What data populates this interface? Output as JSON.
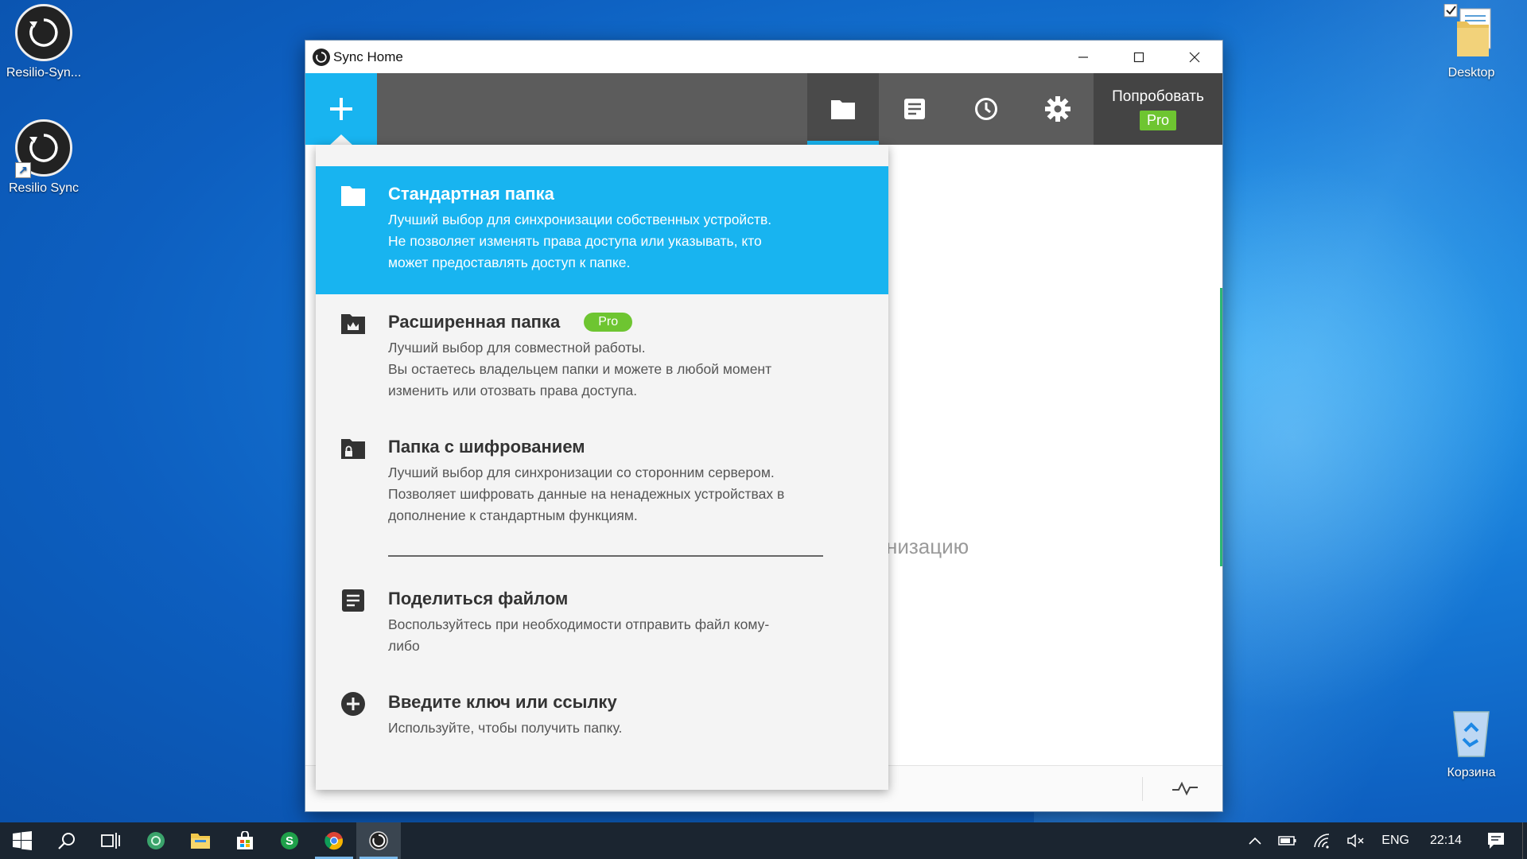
{
  "desktop": {
    "icons": [
      {
        "label": "Resilio-Syn..."
      },
      {
        "label": "Resilio Sync"
      },
      {
        "label": "Desktop"
      },
      {
        "label": "Корзина"
      }
    ]
  },
  "window": {
    "title": "Sync Home",
    "controls": {
      "minimize": "minimize-icon",
      "maximize": "maximize-icon",
      "close": "close-icon"
    }
  },
  "toolbar": {
    "add_icon": "plus-icon",
    "buttons": [
      "folder-icon",
      "document-icon",
      "clock-icon",
      "gear-icon"
    ],
    "active": "folder-icon",
    "try_pro_label": "Попробовать",
    "pro_badge": "Pro"
  },
  "content": {
    "background_hint": "низацию"
  },
  "menu": {
    "items": [
      {
        "title": "Стандартная папка",
        "desc_lines": [
          "Лучший выбор для синхронизации собственных устройств.",
          "Не позволяет изменять права доступа или указывать, кто",
          "может предоставлять доступ к папке."
        ],
        "icon": "folder-icon",
        "selected": true
      },
      {
        "title": "Расширенная папка",
        "badge": "Pro",
        "desc_lines": [
          "Лучший выбор для совместной работы.",
          "Вы остаетесь владельцем папки и можете в любой момент",
          "изменить или отозвать права доступа."
        ],
        "icon": "crown-folder-icon"
      },
      {
        "title": "Папка с шифрованием",
        "desc_lines": [
          "Лучший выбор для синхронизации со сторонним сервером.",
          "Позволяет шифровать данные на ненадежных устройствах в",
          "дополнение к стандартным функциям."
        ],
        "icon": "lock-folder-icon"
      },
      {
        "title": "Поделиться файлом",
        "desc_lines": [
          "Воспользуйтесь при необходимости отправить файл кому-",
          "либо"
        ],
        "icon": "file-icon"
      },
      {
        "title": "Введите ключ или ссылку",
        "desc_lines": [
          "Используйте, чтобы получить папку."
        ],
        "icon": "plus-circle-icon"
      }
    ]
  },
  "taskbar": {
    "language": "ENG",
    "time": "22:14",
    "colors": {
      "background": "#1b2530",
      "accent": "#18b4f0",
      "pro": "#6ec531"
    }
  }
}
